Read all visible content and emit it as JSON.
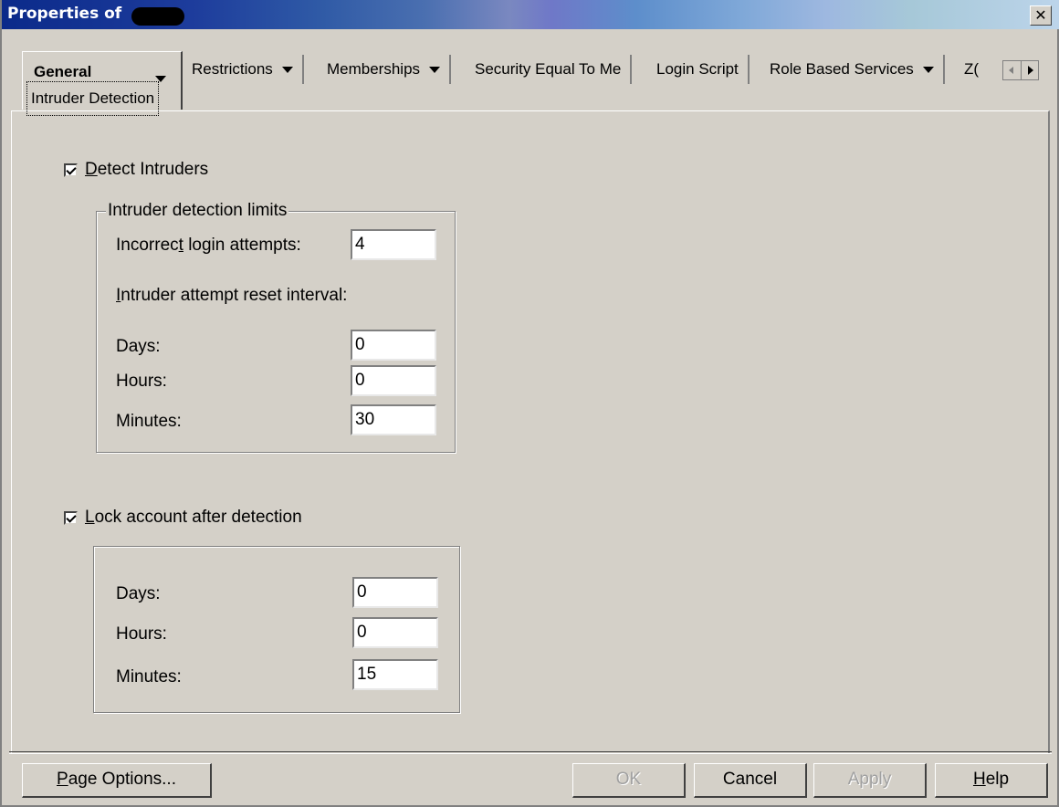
{
  "window": {
    "title": "Properties of",
    "close_label": "✕"
  },
  "tabs": {
    "active": {
      "label": "General",
      "sub_label": "Intruder Detection"
    },
    "items": [
      {
        "label": "Restrictions",
        "has_dropdown": true
      },
      {
        "label": "Memberships",
        "has_dropdown": true
      },
      {
        "label": "Security Equal To Me",
        "has_dropdown": false
      },
      {
        "label": "Login Script",
        "has_dropdown": false
      },
      {
        "label": "Role Based Services",
        "has_dropdown": true
      },
      {
        "label": "Z(",
        "has_dropdown": false
      }
    ]
  },
  "detect_intruders": {
    "checked": true,
    "label_underlined": "D",
    "label_rest": "etect Intruders"
  },
  "limits": {
    "legend": "Intruder detection limits",
    "incorrect_login_pre": "Incorrec",
    "incorrect_login_ul": "t",
    "incorrect_login_post": " login attempts:",
    "incorrect_login_value": "4",
    "reset_ul": "I",
    "reset_rest": "ntruder attempt reset interval:",
    "days_label": "Days:",
    "days_value": "0",
    "hours_label": "Hours:",
    "hours_value": "0",
    "minutes_label": "Minutes:",
    "minutes_value": "30"
  },
  "lock_account": {
    "checked": true,
    "label_underlined": "L",
    "label_rest": "ock account after detection",
    "days_label": "Days:",
    "days_value": "0",
    "hours_label": "Hours:",
    "hours_value": "0",
    "minutes_label": "Minutes:",
    "minutes_value": "15"
  },
  "buttons": {
    "page_options_ul": "P",
    "page_options_rest": "age Options...",
    "ok": "OK",
    "cancel": "Cancel",
    "apply": "Apply",
    "help_ul": "H",
    "help_rest": "elp"
  },
  "colors": {
    "face": "#d4d0c8",
    "title_start": "#0b2a8a",
    "title_end": "#bcd4ea"
  }
}
